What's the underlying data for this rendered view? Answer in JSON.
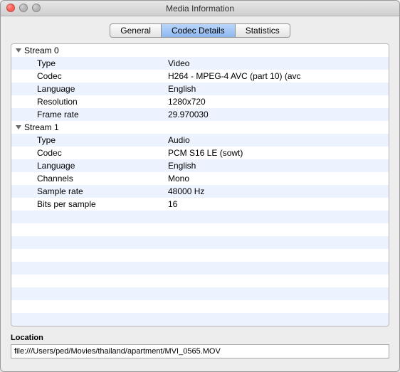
{
  "window": {
    "title": "Media Information"
  },
  "tabs": {
    "general": "General",
    "codec": "Codec Details",
    "stats": "Statistics"
  },
  "streams": [
    {
      "header": "Stream 0",
      "rows": [
        {
          "k": "Type",
          "v": "Video"
        },
        {
          "k": "Codec",
          "v": "H264 - MPEG-4 AVC (part 10) (avc"
        },
        {
          "k": "Language",
          "v": "English"
        },
        {
          "k": "Resolution",
          "v": "1280x720"
        },
        {
          "k": "Frame rate",
          "v": "29.970030"
        }
      ]
    },
    {
      "header": "Stream 1",
      "rows": [
        {
          "k": "Type",
          "v": "Audio"
        },
        {
          "k": "Codec",
          "v": "PCM S16 LE (sowt)"
        },
        {
          "k": "Language",
          "v": "English"
        },
        {
          "k": "Channels",
          "v": "Mono"
        },
        {
          "k": "Sample rate",
          "v": "48000 Hz"
        },
        {
          "k": "Bits per sample",
          "v": "16"
        }
      ]
    }
  ],
  "location": {
    "label": "Location",
    "value": "file:///Users/ped/Movies/thailand/apartment/MVI_0565.MOV"
  }
}
